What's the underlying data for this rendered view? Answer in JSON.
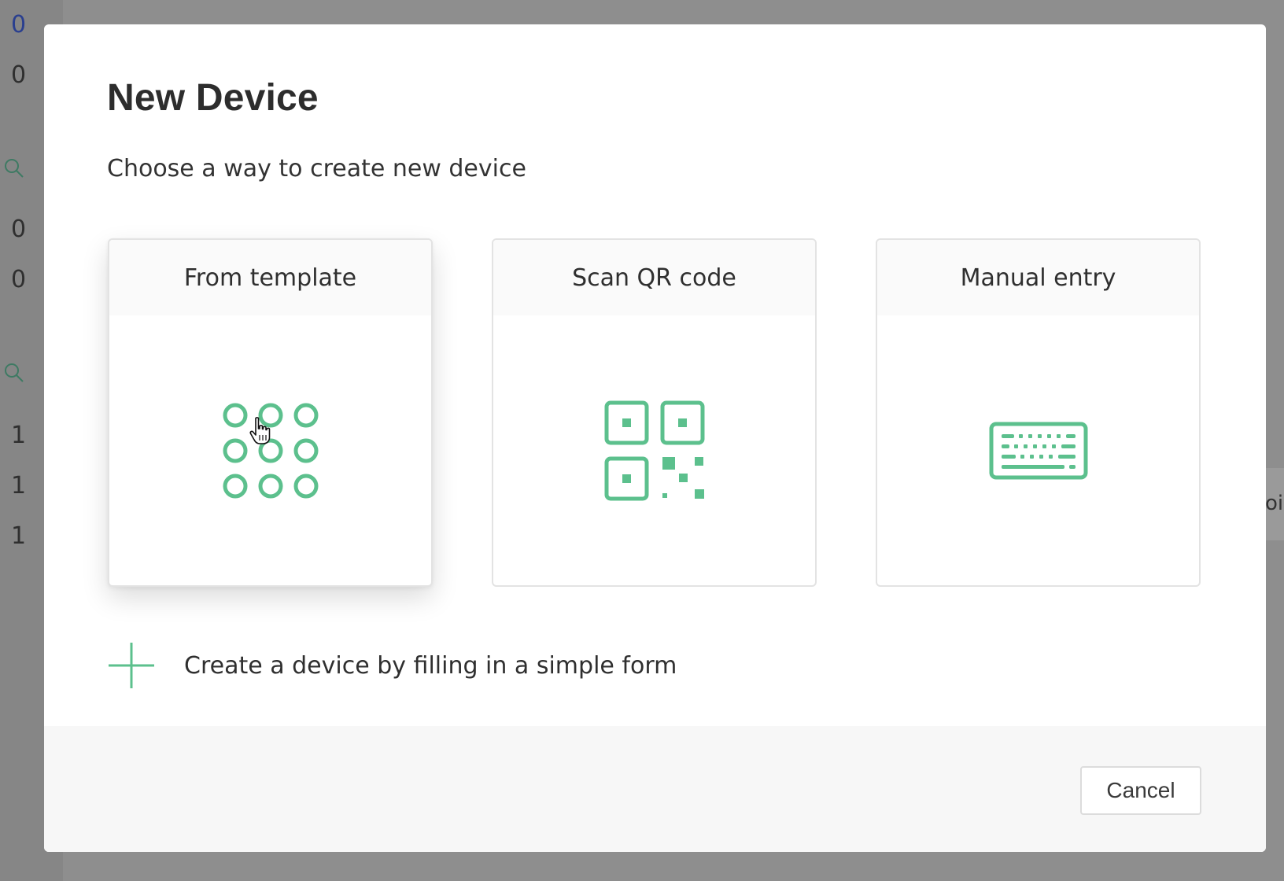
{
  "background": {
    "left_values": [
      "0",
      "0",
      "0",
      "0",
      "1",
      "1",
      "1"
    ],
    "right_chip_text": "oi"
  },
  "modal": {
    "title": "New Device",
    "subtitle": "Choose a way to create new device",
    "options": [
      {
        "label": "From template",
        "icon": "template-grid-icon"
      },
      {
        "label": "Scan QR code",
        "icon": "qr-code-icon"
      },
      {
        "label": "Manual entry",
        "icon": "keyboard-icon"
      }
    ],
    "form_link": {
      "icon": "plus-icon",
      "text": "Create a device by filling in a simple form"
    },
    "cancel_label": "Cancel"
  },
  "colors": {
    "accent": "#5cc08d",
    "overlay": "#8e8e8e",
    "footer": "#f7f7f7"
  }
}
